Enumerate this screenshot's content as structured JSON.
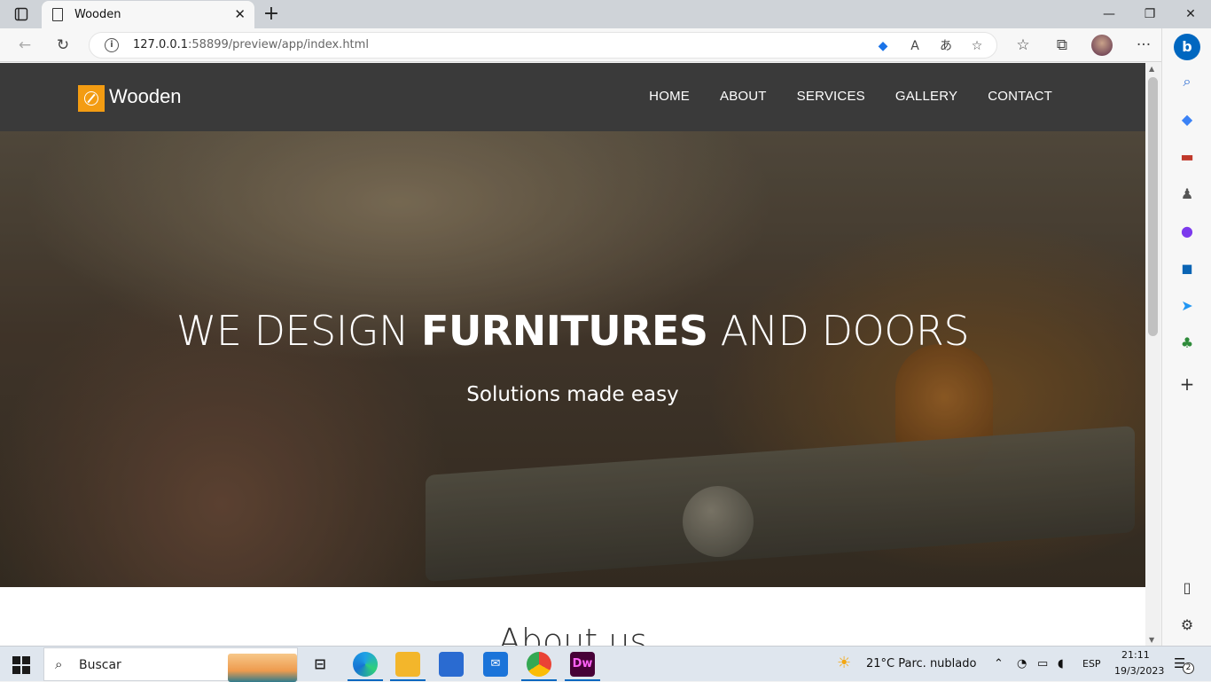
{
  "browser": {
    "tab_title": "Wooden",
    "new_tab_label": "+",
    "url_host": "127.0.0.1",
    "url_rest": ":58899/preview/app/index.html",
    "window_controls": {
      "minimize": "—",
      "restore": "❐",
      "close": "✕"
    }
  },
  "site": {
    "brand": "Wooden",
    "nav": [
      "HOME",
      "ABOUT",
      "SERVICES",
      "GALLERY",
      "CONTACT"
    ],
    "hero": {
      "title_pre": "WE DESIGN ",
      "title_bold": "FURNITURES",
      "title_post": " AND DOORS",
      "subtitle": "Solutions made easy"
    },
    "about_heading": "About us"
  },
  "taskbar": {
    "search_placeholder": "Buscar",
    "weather": "21°C  Parc. nublado",
    "language": "ESP",
    "time": "21:11",
    "date": "19/3/2023",
    "notification_count": "2"
  },
  "colors": {
    "brand_accent": "#f39c12",
    "header_bg": "#3a3a3a",
    "edge_accent": "#0067c0"
  }
}
